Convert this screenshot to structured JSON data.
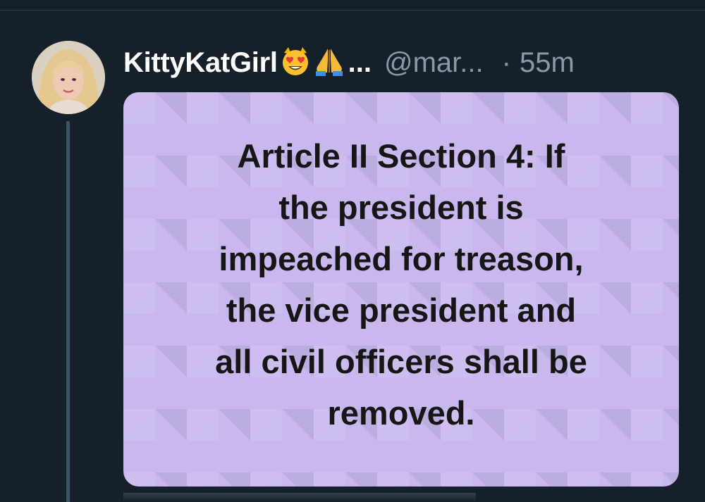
{
  "tweet": {
    "author": {
      "display_name": "KittyKatGirl",
      "emojis": [
        "heart-eyes-cat-icon",
        "praying-hands-icon"
      ],
      "truncation": "...",
      "handle": "@mar...",
      "separator": "·",
      "time": "55m"
    },
    "media": {
      "text": "Article II Section 4: If\nthe president is\nimpeached for treason,\nthe vice president and\nall civil officers shall be\nremoved.",
      "background_color": "#c8b8ee"
    }
  },
  "colors": {
    "background": "#15202b",
    "secondary_text": "#8b98a5",
    "thread_line": "#3d5466"
  }
}
